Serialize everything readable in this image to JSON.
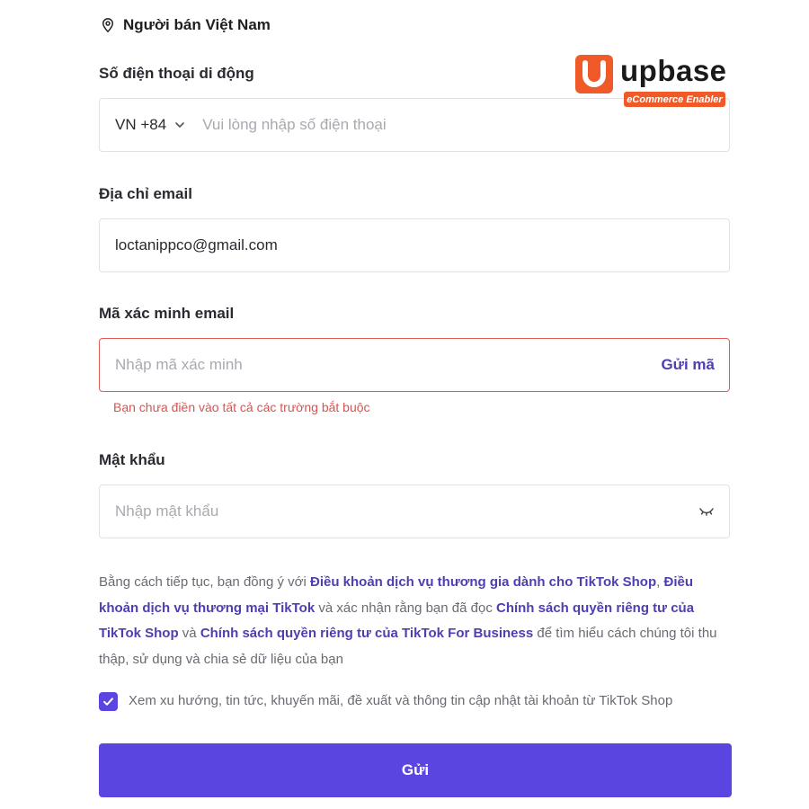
{
  "seller": {
    "icon": "location-pin-icon",
    "label": "Người bán Việt Nam"
  },
  "phone": {
    "label": "Số điện thoại di động",
    "country_code": "VN +84",
    "placeholder": "Vui lòng nhập số điện thoại",
    "value": ""
  },
  "email": {
    "label": "Địa chỉ email",
    "value": "loctanippco@gmail.com"
  },
  "verify": {
    "label": "Mã xác minh email",
    "placeholder": "Nhập mã xác minh",
    "send_code": "Gửi mã",
    "error": "Bạn chưa điền vào tất cả các trường bắt buộc"
  },
  "password": {
    "label": "Mật khẩu",
    "placeholder": "Nhập mật khẩu",
    "toggle_icon": "eye-closed-icon"
  },
  "terms": {
    "t1": "Bằng cách tiếp tục, bạn đồng ý với ",
    "link1": "Điều khoản dịch vụ thương gia dành cho TikTok Shop",
    "t2": ", ",
    "link2": "Điều khoản dịch vụ thương mại TikTok",
    "t3": " và xác nhận rằng bạn đã đọc ",
    "link3": "Chính sách quyền riêng tư của TikTok Shop",
    "t4": " và ",
    "link4": "Chính sách quyền riêng tư của TikTok For Business",
    "t5": " để tìm hiểu cách chúng tôi thu thập, sử dụng và chia sẻ dữ liệu của bạn"
  },
  "subscribe": {
    "checked": true,
    "label": "Xem xu hướng, tin tức, khuyến mãi, đề xuất và thông tin cập nhật tài khoản từ TikTok Shop"
  },
  "submit_label": "Gửi",
  "watermark": {
    "brand": "upbase",
    "tagline": "eCommerce Enabler"
  },
  "colors": {
    "accent": "#5a45e0",
    "link": "#4d3fb0",
    "error": "#d9534f",
    "brand_orange": "#f05a28"
  }
}
